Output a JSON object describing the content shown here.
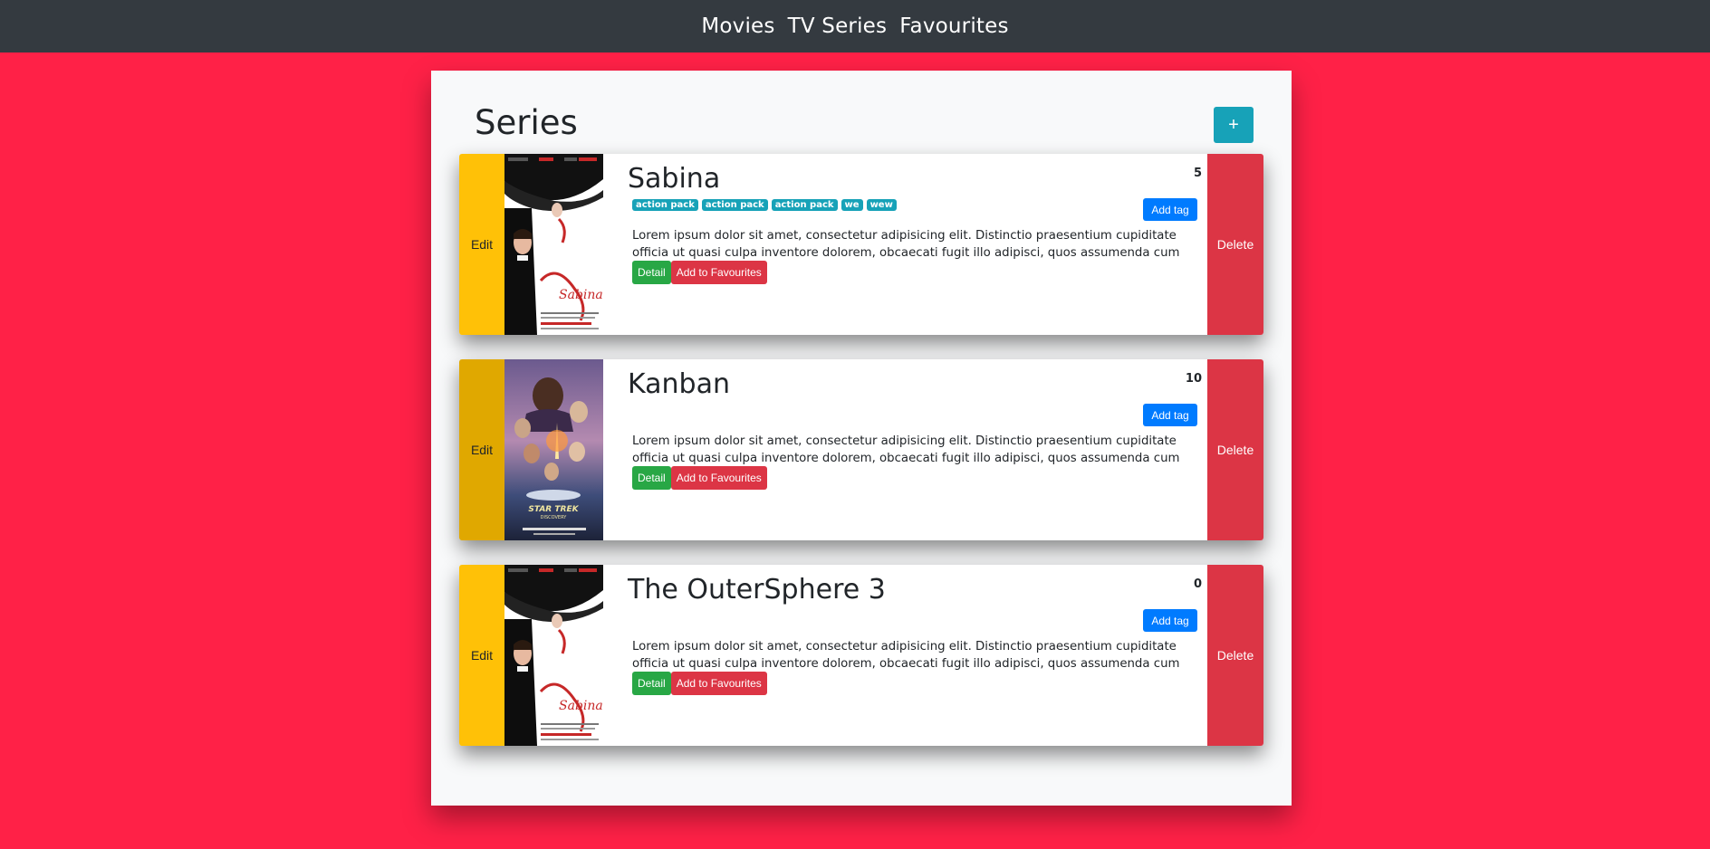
{
  "nav": {
    "movies": "Movies",
    "tv_series": "TV Series",
    "favourites": "Favourites"
  },
  "page": {
    "title": "Series",
    "add_button": "+"
  },
  "series": [
    {
      "title": "Sabina",
      "rating": "5",
      "tags": [
        "action pack",
        "action pack",
        "action pack",
        "we",
        "wew"
      ],
      "poster": "sabrina-poster",
      "description": "Lorem ipsum dolor sit amet, consectetur adipisicing elit. Distinctio praesentium cupiditate officia ut quasi culpa inventore dolorem, obcaecati fugit illo adipisci, quos assumenda cum quas"
    },
    {
      "title": "Kanban",
      "rating": "10",
      "tags": [],
      "poster": "star-trek-poster",
      "description": "Lorem ipsum dolor sit amet, consectetur adipisicing elit. Distinctio praesentium cupiditate officia ut quasi culpa inventore dolorem, obcaecati fugit illo adipisci, quos assumenda cum quas"
    },
    {
      "title": "The OuterSphere 3",
      "rating": "0",
      "tags": [],
      "poster": "sabrina-poster",
      "description": "Lorem ipsum dolor sit amet, consectetur adipisicing elit. Distinctio praesentium cupiditate officia ut quasi culpa inventore dolorem, obcaecati fugit illo adipisci, quos assumenda cum quas"
    }
  ],
  "labels": {
    "edit": "Edit",
    "delete": "Delete",
    "add_tag": "Add tag",
    "detail": "Detail",
    "add_to_favourites": "Add to Favourites"
  },
  "colors": {
    "background": "#ff2147",
    "navbar": "#343a40",
    "edit": "#ffc107",
    "delete": "#dc3545",
    "add_tag": "#007bff",
    "detail": "#28a745",
    "tag": "#17a2b8"
  }
}
